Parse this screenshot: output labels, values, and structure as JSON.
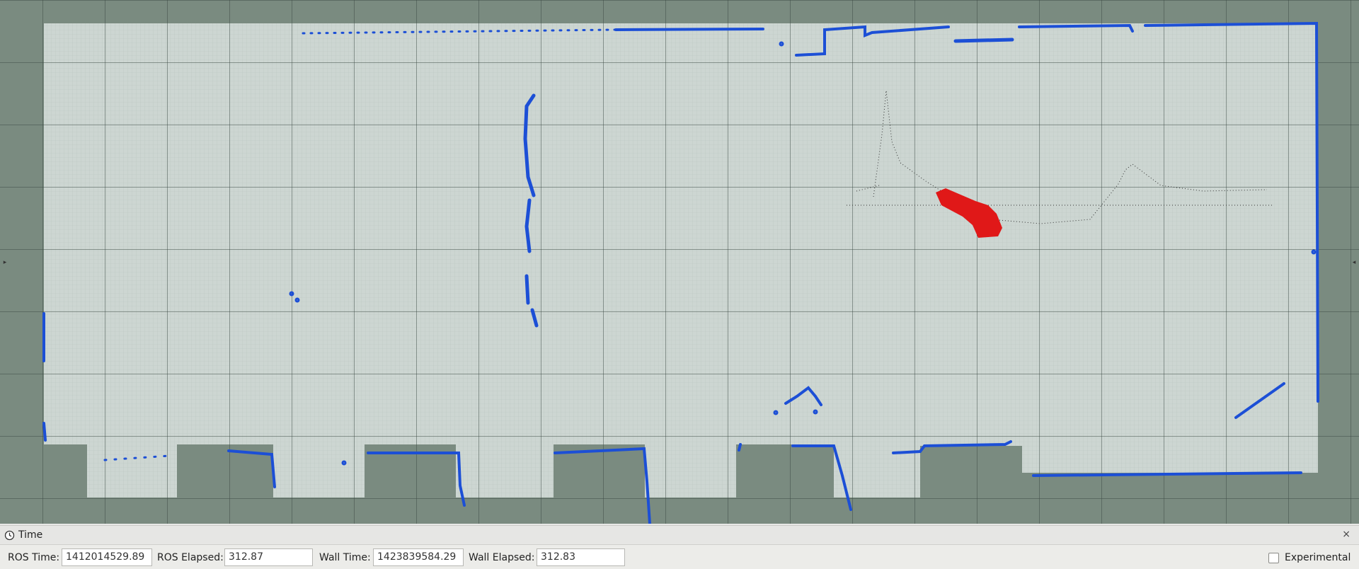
{
  "panel": {
    "title": "Time",
    "close_glyph": "×",
    "icons": {
      "panel": "clock-icon",
      "close": "close-icon"
    }
  },
  "time_bar": {
    "ros_time_label": "ROS Time:",
    "ros_time_value": "1412014529.89",
    "ros_elapsed_label": "ROS Elapsed:",
    "ros_elapsed_value": "312.87",
    "wall_time_label": "Wall Time:",
    "wall_time_value": "1423839584.29",
    "wall_elapsed_label": "Wall Elapsed:",
    "wall_elapsed_value": "312.83",
    "experimental_label": "Experimental",
    "experimental_checked": false
  },
  "viewport": {
    "colors": {
      "background": "#7a8b80",
      "free_space": "#cdd6d2",
      "walls": "#1c4fd6",
      "robot": "#e01818",
      "trail": "#333333"
    },
    "handles": {
      "left": "▸",
      "right": "◂"
    }
  }
}
